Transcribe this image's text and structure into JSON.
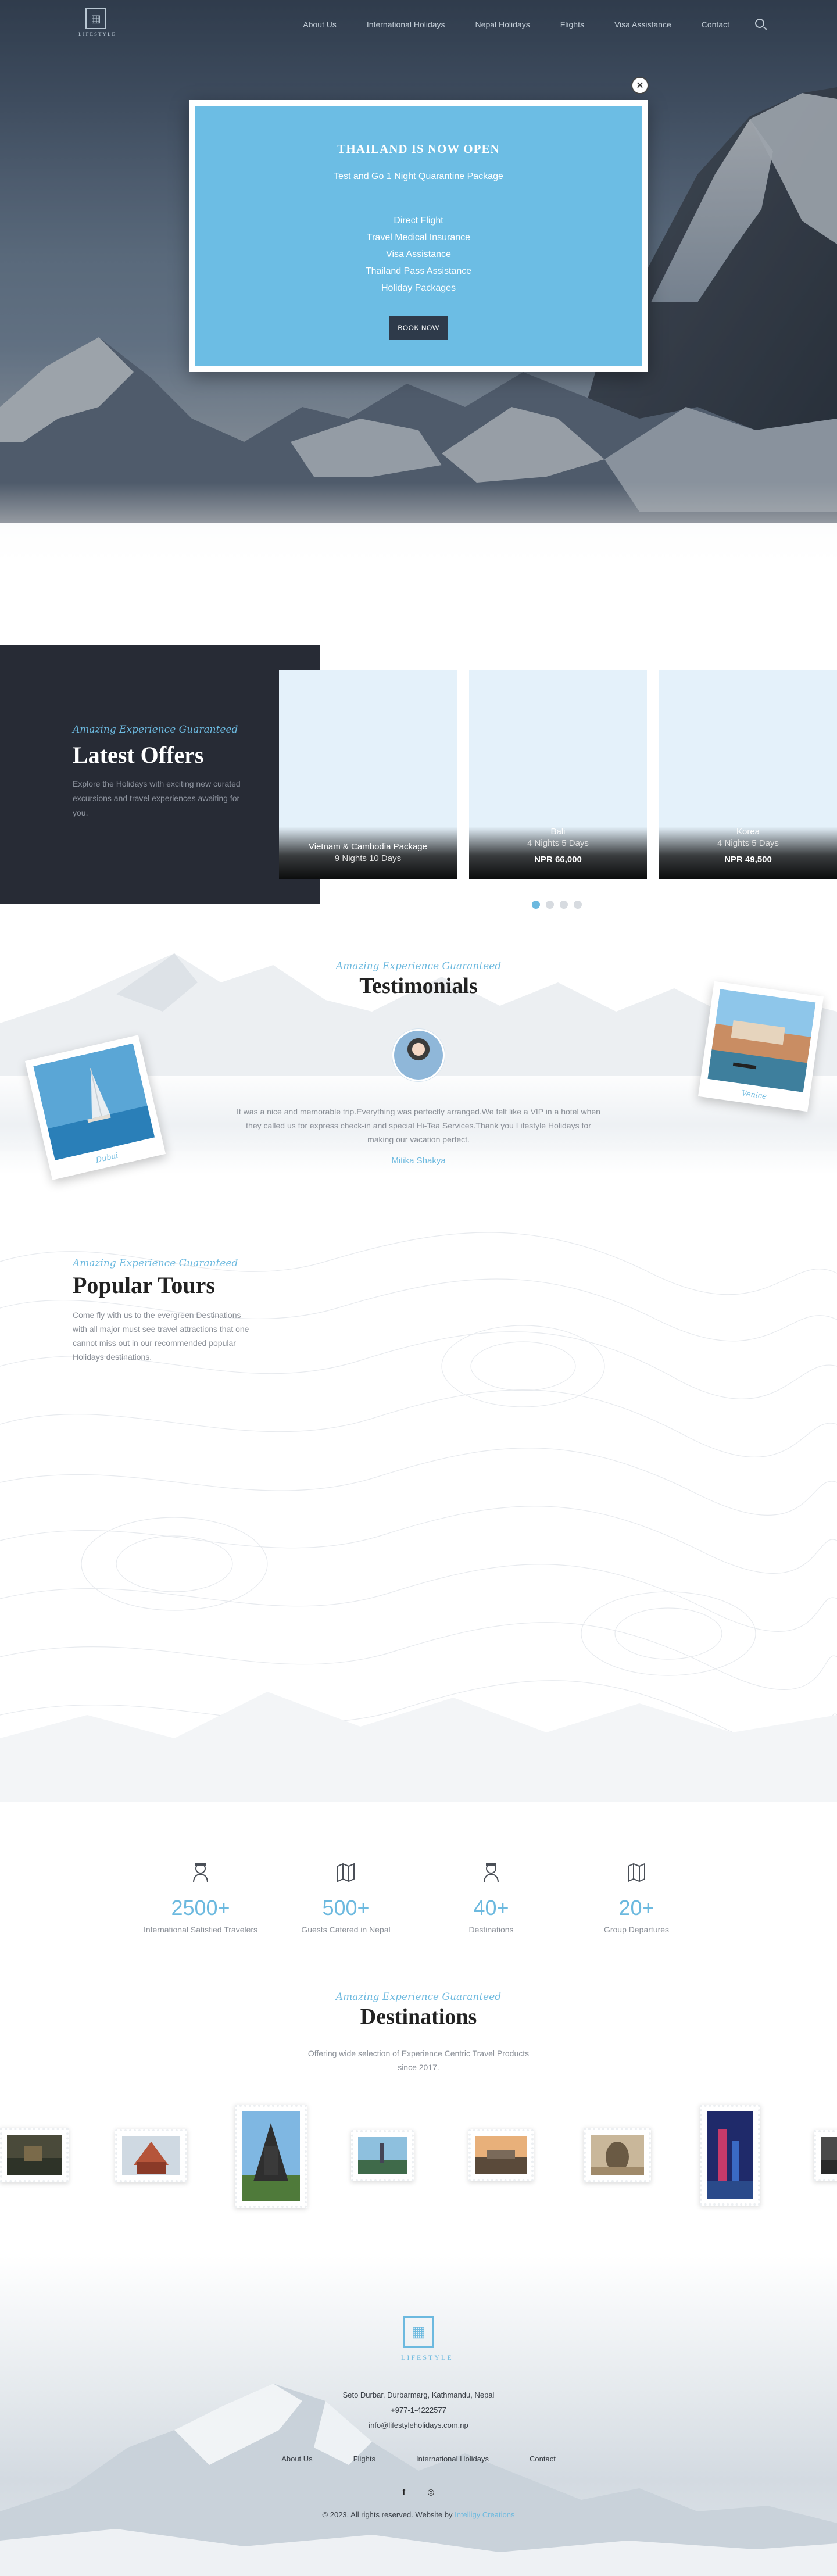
{
  "brand": {
    "logo_word": "LIFESTYLE",
    "footer_word": "LIFESTYLE"
  },
  "nav": {
    "items": [
      "About Us",
      "International Holidays",
      "Nepal Holidays",
      "Flights",
      "Visa Assistance",
      "Contact"
    ]
  },
  "popup": {
    "title": "THAILAND IS NOW OPEN",
    "subtitle": "Test and Go 1 Night Quarantine Package",
    "items": [
      "Direct Flight",
      "Travel Medical Insurance",
      "Visa Assistance",
      "Thailand Pass Assistance",
      "Holiday Packages"
    ],
    "button": "BOOK NOW",
    "close": "×"
  },
  "offers": {
    "tagline": "Amazing Experience Guaranteed",
    "title": "Latest Offers",
    "text": "Explore the Holidays with exciting new curated excursions and travel experiences awaiting for you.",
    "cards": [
      {
        "title": "Vietnam & Cambodia Package",
        "duration": "9 Nights 10 Days",
        "price": ""
      },
      {
        "title": "Bali",
        "duration": "4 Nights 5 Days",
        "price": "NPR 66,000"
      },
      {
        "title": "Korea",
        "duration": "4 Nights 5 Days",
        "price": "NPR 49,500"
      }
    ],
    "active_slide": 1,
    "slide_count": 4
  },
  "testimonials": {
    "tagline": "Amazing Experience Guaranteed",
    "title": "Testimonials",
    "quote": "It was a nice and memorable trip.Everything was perfectly arranged.We felt like a VIP in a hotel when they called us for express check-in and special Hi-Tea Services.Thank you Lifestyle Holidays for making our vacation perfect.",
    "author": "Mitika Shakya",
    "polaroid_left": "Dubai",
    "polaroid_right": "Venice"
  },
  "tours": {
    "tagline": "Amazing Experience Guaranteed",
    "title": "Popular Tours",
    "text": "Come fly with us to the evergreen Destinations with all major must see travel attractions that one cannot miss out in our recommended popular Holidays destinations."
  },
  "stats": [
    {
      "icon": "pilot-icon",
      "value": "2500+",
      "label": "International Satisfied Travelers"
    },
    {
      "icon": "map-icon",
      "value": "500+",
      "label": "Guests Catered in Nepal"
    },
    {
      "icon": "pilot-icon",
      "value": "40+",
      "label": "Destinations"
    },
    {
      "icon": "map-icon",
      "value": "20+",
      "label": "Group Departures"
    }
  ],
  "destinations": {
    "tagline": "Amazing Experience Guaranteed",
    "title": "Destinations",
    "text": "Offering wide selection of Experience Centric Travel Products since 2017."
  },
  "footer": {
    "address": "Seto Durbar, Durbarmarg, Kathmandu, Nepal",
    "phone": "+977-1-4222577",
    "email": "info@lifestyleholidays.com.np",
    "links": [
      "About Us",
      "Flights",
      "International Holidays",
      "Contact"
    ],
    "social": [
      "f",
      "◎"
    ],
    "copyright": "© 2023. All rights reserved. Website by",
    "credit": "Intelligy Creations"
  },
  "colors": {
    "accent": "#6cb9df",
    "dark": "#272b35",
    "popup": "#6cbde4",
    "button": "#2e3a4a"
  }
}
